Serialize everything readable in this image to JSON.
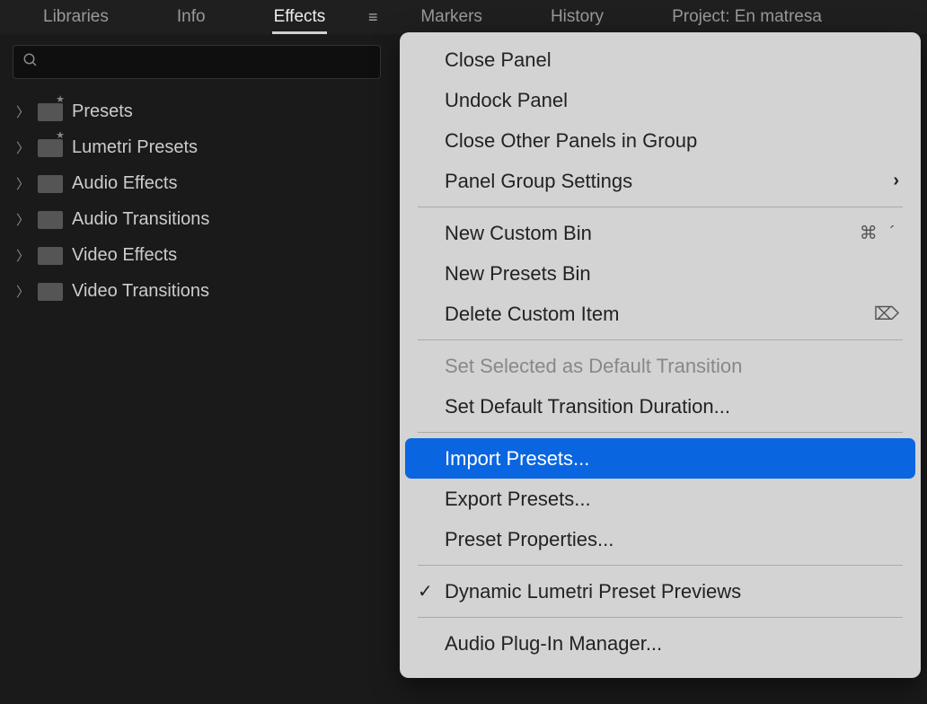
{
  "tabs": {
    "items": [
      {
        "label": "Libraries",
        "active": false
      },
      {
        "label": "Info",
        "active": false
      },
      {
        "label": "Effects",
        "active": true
      },
      {
        "label": "Markers",
        "active": false
      },
      {
        "label": "History",
        "active": false
      },
      {
        "label": "Project: En matresa",
        "active": false
      }
    ]
  },
  "search": {
    "value": "",
    "placeholder": ""
  },
  "tree": {
    "items": [
      {
        "label": "Presets",
        "preset": true
      },
      {
        "label": "Lumetri Presets",
        "preset": true
      },
      {
        "label": "Audio Effects",
        "preset": false
      },
      {
        "label": "Audio Transitions",
        "preset": false
      },
      {
        "label": "Video Effects",
        "preset": false
      },
      {
        "label": "Video Transitions",
        "preset": false
      }
    ]
  },
  "menu": {
    "groups": [
      [
        {
          "label": "Close Panel"
        },
        {
          "label": "Undock Panel"
        },
        {
          "label": "Close Other Panels in Group"
        },
        {
          "label": "Panel Group Settings",
          "submenu": true
        }
      ],
      [
        {
          "label": "New Custom Bin",
          "shortcut": "⌘ ´"
        },
        {
          "label": "New Presets Bin"
        },
        {
          "label": "Delete Custom Item",
          "delete_icon": true
        }
      ],
      [
        {
          "label": "Set Selected as Default Transition",
          "disabled": true
        },
        {
          "label": "Set Default Transition Duration..."
        }
      ],
      [
        {
          "label": "Import Presets...",
          "highlight": true
        },
        {
          "label": "Export Presets..."
        },
        {
          "label": "Preset Properties..."
        }
      ],
      [
        {
          "label": "Dynamic Lumetri Preset Previews",
          "checked": true
        }
      ],
      [
        {
          "label": "Audio Plug-In Manager..."
        }
      ]
    ]
  }
}
